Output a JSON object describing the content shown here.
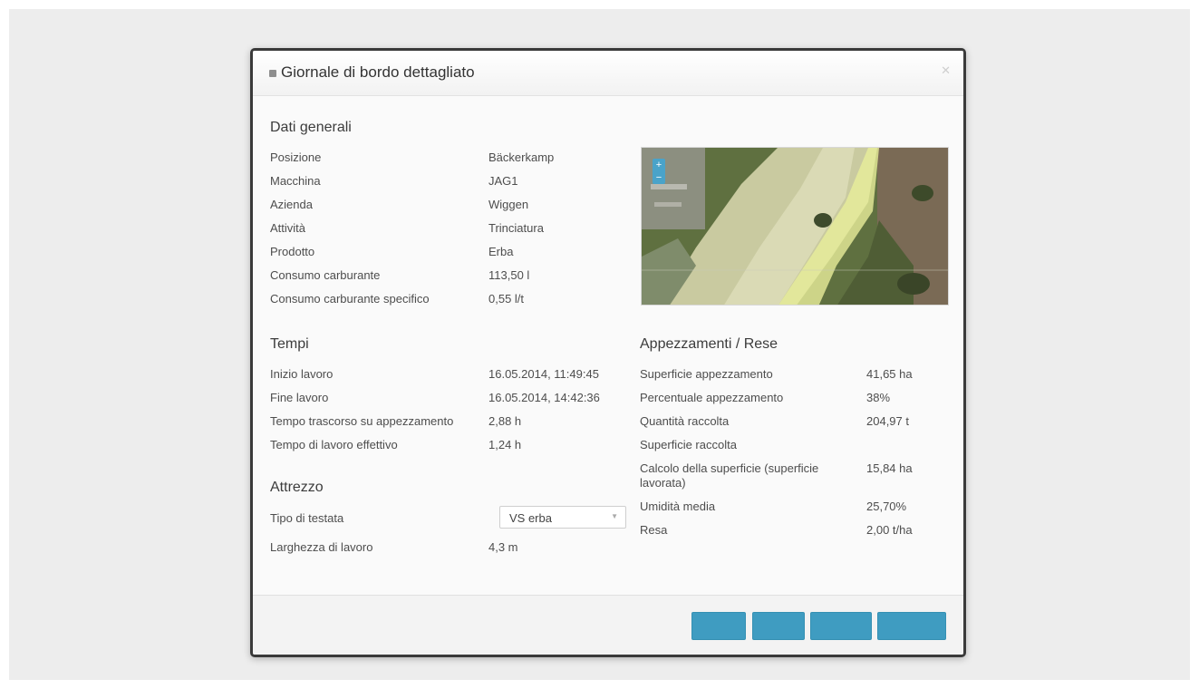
{
  "dialog": {
    "title": "Giornale di bordo dettagliato"
  },
  "general": {
    "title": "Dati generali",
    "rows": [
      {
        "label": "Posizione",
        "value": "Bäckerkamp"
      },
      {
        "label": "Macchina",
        "value": "JAG1"
      },
      {
        "label": "Azienda",
        "value": "Wiggen"
      },
      {
        "label": "Attività",
        "value": "Trinciatura"
      },
      {
        "label": "Prodotto",
        "value": "Erba"
      },
      {
        "label": "Consumo carburante",
        "value": "113,50 l"
      },
      {
        "label": "Consumo carburante specifico",
        "value": "0,55 l/t"
      }
    ]
  },
  "times": {
    "title": "Tempi",
    "rows": [
      {
        "label": "Inizio lavoro",
        "value": "16.05.2014, 11:49:45"
      },
      {
        "label": "Fine lavoro",
        "value": "16.05.2014, 14:42:36"
      },
      {
        "label": "Tempo trascorso su appezzamento",
        "value": "2,88 h"
      },
      {
        "label": "Tempo di lavoro effettivo",
        "value": "1,24 h"
      }
    ]
  },
  "tool": {
    "title": "Attrezzo",
    "header_type_label": "Tipo di testata",
    "header_type_value": "VS erba",
    "width_label": "Larghezza di lavoro",
    "width_value": "4,3 m"
  },
  "fields": {
    "title": "Appezzamenti / Rese",
    "rows": [
      {
        "label": "Superficie appezzamento",
        "value": "41,65 ha"
      },
      {
        "label": "Percentuale appezzamento",
        "value": "38%"
      },
      {
        "label": "Quantità raccolta",
        "value": "204,97 t"
      },
      {
        "label": "Superficie raccolta",
        "value": ""
      },
      {
        "label": "Calcolo della superficie (superficie lavorata)",
        "value": "15,84 ha"
      },
      {
        "label": "Umidità media",
        "value": "25,70%"
      },
      {
        "label": "Resa",
        "value": "2,00 t/ha"
      }
    ]
  },
  "map": {
    "zoom_in": "+",
    "zoom_out": "−"
  },
  "footer": {
    "buttons": [
      "",
      "",
      "",
      ""
    ]
  },
  "colors": {
    "button": "#3f9cc1",
    "field_highlight": "#e8ee9a"
  }
}
